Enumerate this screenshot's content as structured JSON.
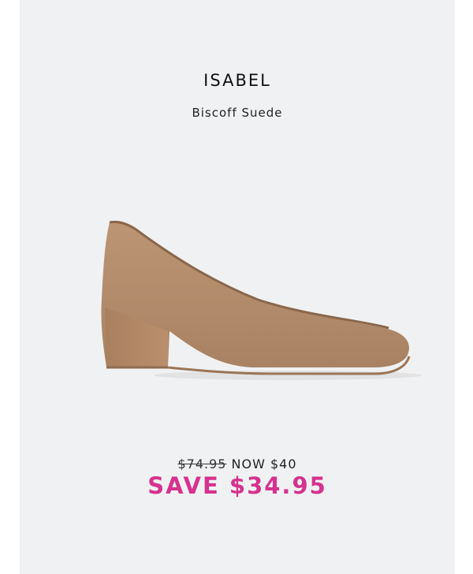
{
  "product": {
    "name": "ISABEL",
    "variant": "Biscoff Suede",
    "image_alt": "tan suede block heel pump"
  },
  "pricing": {
    "original_price": "$74.95",
    "now_price": "NOW $40",
    "savings": "SAVE $34.95"
  },
  "colors": {
    "card_background": "#f0f1f2",
    "savings_accent": "#d6328f",
    "shoe_tan": "#b38d6c"
  }
}
